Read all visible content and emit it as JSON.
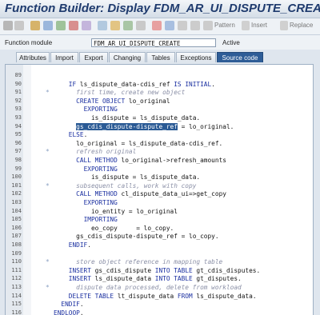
{
  "window": {
    "title": "Function Builder: Display FDM_AR_UI_DISPUTE_CREATE"
  },
  "toolbar": {
    "pattern_label": "Pattern",
    "insert_label": "Insert",
    "replace_label": "Replace"
  },
  "module": {
    "label": "Function module",
    "value": "FDM_AR_UI_DISPUTE_CREATE",
    "status": "Active"
  },
  "tabs": [
    {
      "label": "Attributes"
    },
    {
      "label": "Import"
    },
    {
      "label": "Export"
    },
    {
      "label": "Changing"
    },
    {
      "label": "Tables"
    },
    {
      "label": "Exceptions"
    },
    {
      "label": "Source code"
    }
  ],
  "lines": [
    {
      "num": "89",
      "indent": "",
      "marker": "",
      "parts": []
    },
    {
      "num": "90",
      "indent": "    ",
      "marker": "",
      "parts": [
        {
          "t": "kw",
          "v": "IF "
        },
        {
          "t": "pl",
          "v": "ls_dispute_data-cdis_ref "
        },
        {
          "t": "kw",
          "v": "IS INITIAL"
        },
        {
          "t": "pl",
          "v": "."
        }
      ]
    },
    {
      "num": "91",
      "indent": "",
      "marker": "*",
      "parts": [
        {
          "t": "cm",
          "v": "      first time, create new object"
        }
      ]
    },
    {
      "num": "92",
      "indent": "      ",
      "marker": "",
      "parts": [
        {
          "t": "kw",
          "v": "CREATE OBJECT "
        },
        {
          "t": "pl",
          "v": "lo_original"
        }
      ]
    },
    {
      "num": "93",
      "indent": "        ",
      "marker": "",
      "parts": [
        {
          "t": "kw",
          "v": "EXPORTING"
        }
      ]
    },
    {
      "num": "93",
      "indent": "          ",
      "marker": "",
      "parts": [
        {
          "t": "pl",
          "v": "is_dispute = ls_dispute_data."
        }
      ]
    },
    {
      "num": "94",
      "indent": "      ",
      "marker": "",
      "parts": [
        {
          "t": "hl",
          "v": "gs_cdis_dispute-dispute_ref"
        },
        {
          "t": "pl",
          "v": " = lo_original."
        }
      ]
    },
    {
      "num": "95",
      "indent": "    ",
      "marker": "",
      "parts": [
        {
          "t": "kw",
          "v": "ELSE"
        },
        {
          "t": "pl",
          "v": "."
        }
      ]
    },
    {
      "num": "96",
      "indent": "      ",
      "marker": "",
      "parts": [
        {
          "t": "pl",
          "v": "lo_original = ls_dispute_data-cdis_ref."
        }
      ]
    },
    {
      "num": "97",
      "indent": "",
      "marker": "*",
      "parts": [
        {
          "t": "cm",
          "v": "      refresh original"
        }
      ]
    },
    {
      "num": "98",
      "indent": "      ",
      "marker": "",
      "parts": [
        {
          "t": "kw",
          "v": "CALL METHOD "
        },
        {
          "t": "pl",
          "v": "lo_original->refresh_amounts"
        }
      ]
    },
    {
      "num": "99",
      "indent": "        ",
      "marker": "",
      "parts": [
        {
          "t": "kw",
          "v": "EXPORTING"
        }
      ]
    },
    {
      "num": "100",
      "indent": "          ",
      "marker": "",
      "parts": [
        {
          "t": "pl",
          "v": "is_dispute = ls_dispute_data."
        }
      ]
    },
    {
      "num": "101",
      "indent": "",
      "marker": "*",
      "parts": [
        {
          "t": "cm",
          "v": "      subsequent calls, work with copy"
        }
      ]
    },
    {
      "num": "102",
      "indent": "      ",
      "marker": "",
      "parts": [
        {
          "t": "kw",
          "v": "CALL METHOD "
        },
        {
          "t": "pl",
          "v": "cl_dispute_data_ui=>get_copy"
        }
      ]
    },
    {
      "num": "103",
      "indent": "        ",
      "marker": "",
      "parts": [
        {
          "t": "kw",
          "v": "EXPORTING"
        }
      ]
    },
    {
      "num": "104",
      "indent": "          ",
      "marker": "",
      "parts": [
        {
          "t": "pl",
          "v": "io_entity = lo_original"
        }
      ]
    },
    {
      "num": "105",
      "indent": "        ",
      "marker": "",
      "parts": [
        {
          "t": "kw",
          "v": "IMPORTING"
        }
      ]
    },
    {
      "num": "106",
      "indent": "          ",
      "marker": "",
      "parts": [
        {
          "t": "pl",
          "v": "eo_copy     = lo_copy."
        }
      ]
    },
    {
      "num": "107",
      "indent": "      ",
      "marker": "",
      "parts": [
        {
          "t": "pl",
          "v": "gs_cdis_dispute-dispute_ref = lo_copy."
        }
      ]
    },
    {
      "num": "108",
      "indent": "    ",
      "marker": "",
      "parts": [
        {
          "t": "kw",
          "v": "ENDIF"
        },
        {
          "t": "pl",
          "v": "."
        }
      ]
    },
    {
      "num": "109",
      "indent": "",
      "marker": "",
      "parts": []
    },
    {
      "num": "110",
      "indent": "",
      "marker": "*",
      "parts": [
        {
          "t": "cm",
          "v": "      store object reference in mapping table"
        }
      ]
    },
    {
      "num": "111",
      "indent": "    ",
      "marker": "",
      "parts": [
        {
          "t": "kw",
          "v": "INSERT "
        },
        {
          "t": "pl",
          "v": "gs_cdis_dispute "
        },
        {
          "t": "kw",
          "v": "INTO TABLE "
        },
        {
          "t": "pl",
          "v": "gt_cdis_disputes."
        }
      ]
    },
    {
      "num": "112",
      "indent": "    ",
      "marker": "",
      "parts": [
        {
          "t": "kw",
          "v": "INSERT "
        },
        {
          "t": "pl",
          "v": "ls_dispute_data "
        },
        {
          "t": "kw",
          "v": "INTO TABLE "
        },
        {
          "t": "pl",
          "v": "gt_disputes."
        }
      ]
    },
    {
      "num": "113",
      "indent": "",
      "marker": "*",
      "parts": [
        {
          "t": "cm",
          "v": "      dispute data processed, delete from workload"
        }
      ]
    },
    {
      "num": "114",
      "indent": "    ",
      "marker": "",
      "parts": [
        {
          "t": "kw",
          "v": "DELETE TABLE "
        },
        {
          "t": "pl",
          "v": "lt_dispute_data "
        },
        {
          "t": "kw",
          "v": "FROM "
        },
        {
          "t": "pl",
          "v": "ls_dispute_data."
        }
      ]
    },
    {
      "num": "115",
      "indent": "  ",
      "marker": "",
      "parts": [
        {
          "t": "kw",
          "v": "ENDIF"
        },
        {
          "t": "pl",
          "v": "."
        }
      ]
    },
    {
      "num": "116",
      "indent": "",
      "marker": "",
      "parts": [
        {
          "t": "kw",
          "v": "ENDLOOP"
        },
        {
          "t": "pl",
          "v": "."
        }
      ]
    }
  ]
}
